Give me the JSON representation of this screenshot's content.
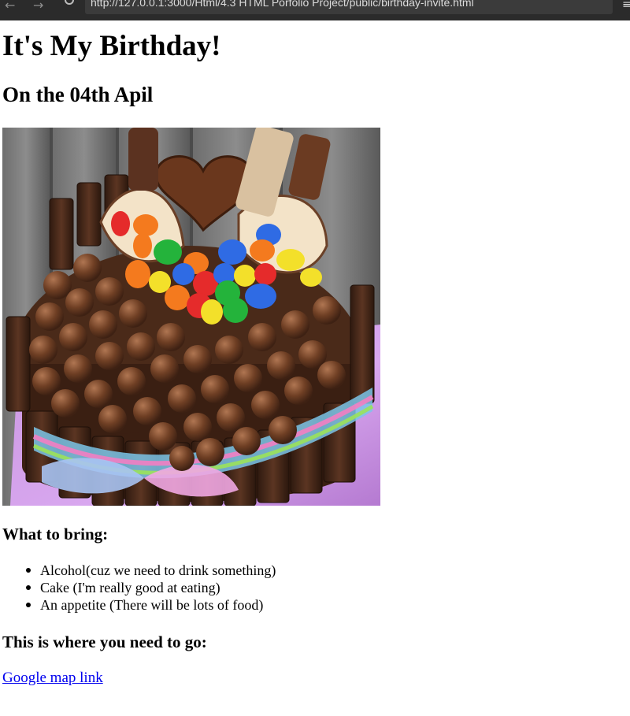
{
  "browser": {
    "url": "http://127.0.0.1:3000/Html/4.3 HTML Porfolio Project/public/birthday-invite.html",
    "back_icon": "←",
    "forward_icon": "→",
    "menu_icon": "≡"
  },
  "page": {
    "title": "It's My Birthday!",
    "date_heading": "On the 04th Apil",
    "image": "chocolate-birthday-cake",
    "bring_heading": "What to bring:",
    "bring_items": [
      "Alcohol(cuz we need to drink something)",
      "Cake (I'm really good at eating)",
      "An appetite (There will be lots of food)"
    ],
    "where_heading": "This is where you need to go:",
    "map_link": "Google map link"
  }
}
